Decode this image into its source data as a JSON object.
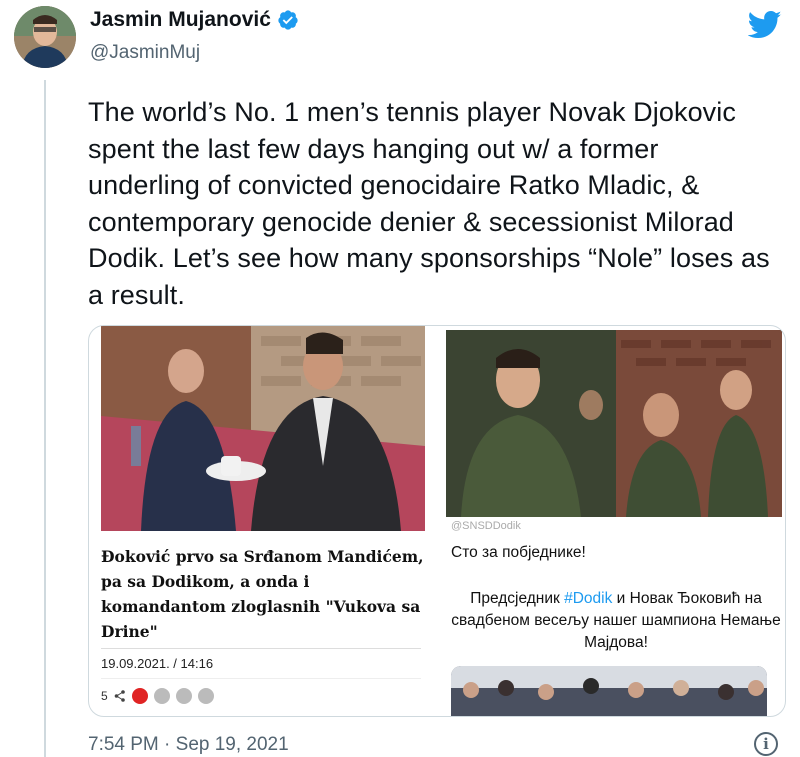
{
  "author": {
    "name": "Jasmin Mujanović",
    "handle": "@JasminMuj"
  },
  "tweet": {
    "text": "The world’s No. 1 men’s tennis player Novak Djokovic spent the last few days hanging out w/ a former underling of convicted genocidaire Ratko Mladic, & contemporary genocide denier & secessionist Milorad Dodik. Let’s see how many sponsorships “Nole” loses as a result.",
    "timestamp": "7:54 PM · Sep 19, 2021"
  },
  "media": {
    "left_article": {
      "headline": "Đoković prvo sa Srđanom Mandićem, pa sa Dodikom, a onda i komandantom zloglasnih \"Vukova sa Drine\"",
      "date": "19.09.2021. / 14:16",
      "share_count": "5"
    },
    "right_post": {
      "handle_fragment": "@SNSDDodik",
      "line1": "Сто за побједнике!",
      "line2_prefix": "Предсједник ",
      "line2_tag": "#Dodik",
      "line2_suffix": " и Новак Ђоковић на свадбеном весељу нашег шампиона Немање Мајдова!"
    }
  },
  "colors": {
    "twitter_blue": "#1d9bf0",
    "text_primary": "#0f1419",
    "text_secondary": "#536471",
    "border": "#cfd9de"
  },
  "icons": [
    "verified-badge-icon",
    "twitter-bird-icon",
    "share-icon",
    "info-icon"
  ]
}
